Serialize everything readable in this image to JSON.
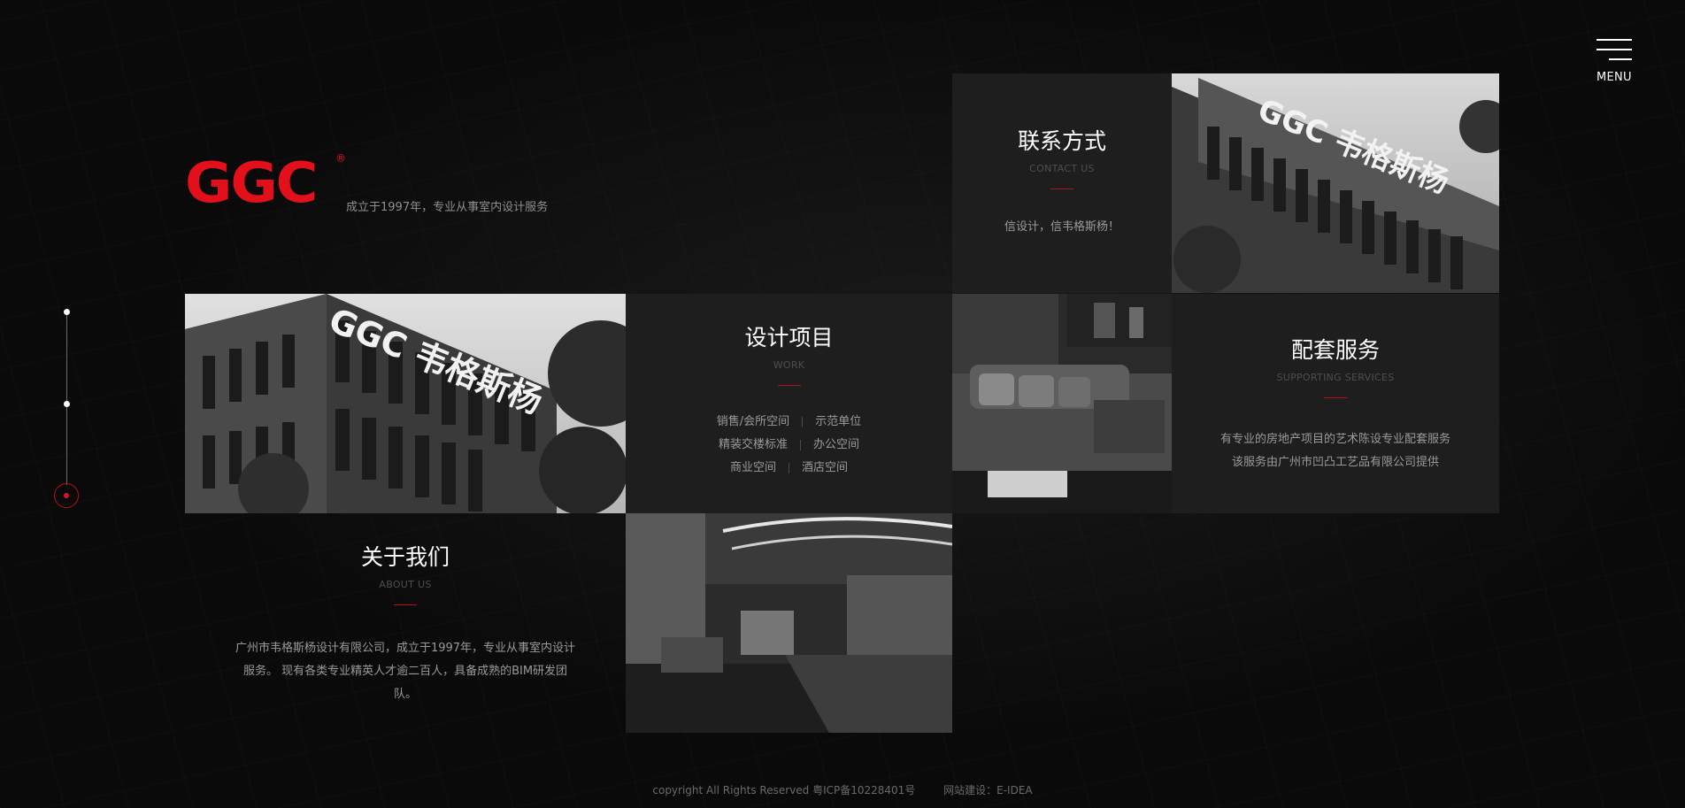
{
  "header": {
    "menu_label": "MENU",
    "logo_text": "GGC",
    "logo_reg": "®",
    "tagline": "成立于1997年，专业从事室内设计服务"
  },
  "contact": {
    "title": "联系方式",
    "subtitle": "CONTACT US",
    "text": "信设计，信韦格斯杨！"
  },
  "work": {
    "title": "设计项目",
    "subtitle": "WORK",
    "items": [
      [
        "销售/会所空间",
        "示范单位"
      ],
      [
        "精装交楼标准",
        "办公空间"
      ],
      [
        "商业空间",
        "酒店空间"
      ]
    ]
  },
  "services": {
    "title": "配套服务",
    "subtitle": "SUPPORTING SERVICES",
    "line1": "有专业的房地产项目的艺术陈设专业配套服务",
    "line2": "该服务由广州市凹凸工艺品有限公司提供"
  },
  "about": {
    "title": "关于我们",
    "subtitle": "ABOUT US",
    "line1": "广州市韦格斯杨设计有限公司，成立于1997年，专业从事室内设计",
    "line2": "服务。 现有各类专业精英人才逾二百人，具备成熟的BIM研发团",
    "line3": "队。"
  },
  "building_sign": "GGC 韦格斯杨",
  "footer": {
    "copyright": "copyright All Rights Reserved 粤ICP备10228401号",
    "credit": "网站建设：E-IDEA"
  },
  "colors": {
    "accent": "#e3101b",
    "tile_bg": "#1e1e1e",
    "page_bg": "#0a0a0a"
  }
}
